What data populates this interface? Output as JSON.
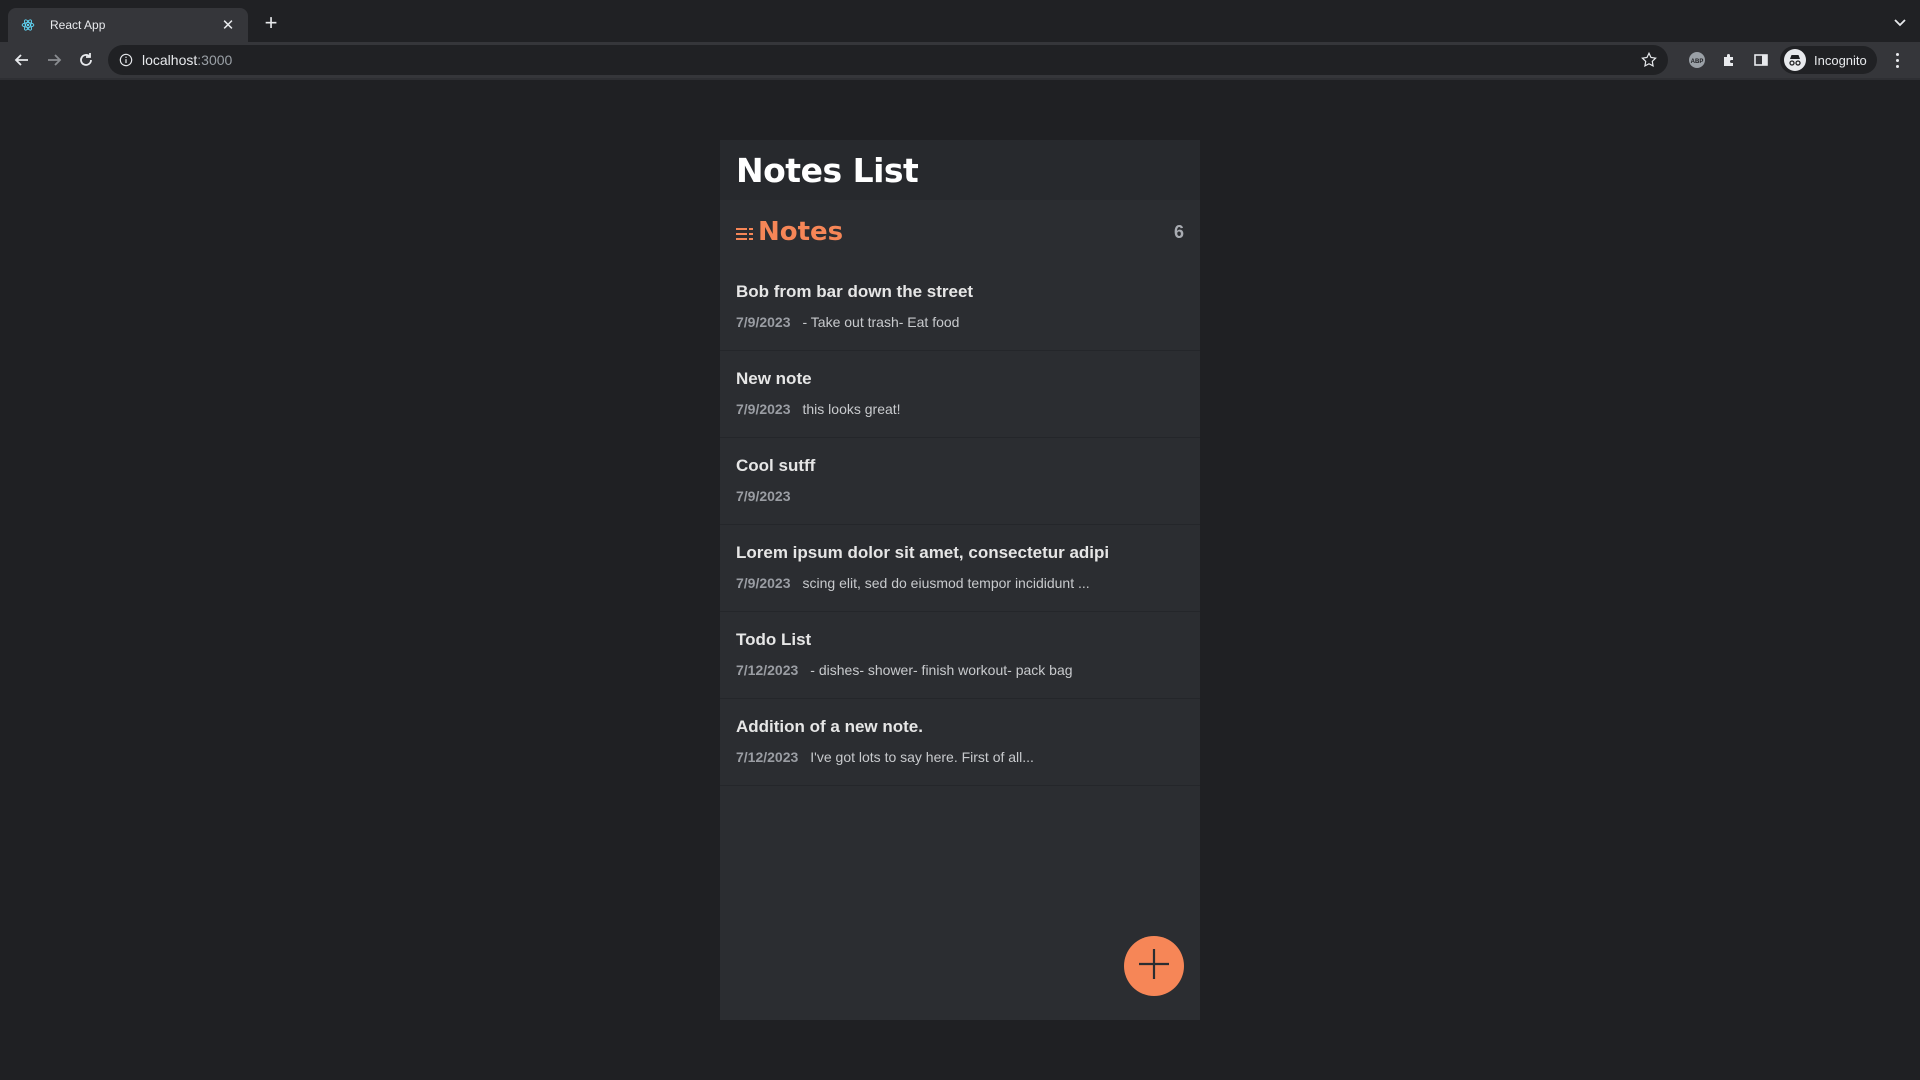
{
  "browser": {
    "tab_title": "React App",
    "url_host": "localhost",
    "url_port": ":3000",
    "profile_label": "Incognito"
  },
  "app": {
    "title": "Notes List",
    "notes_heading": "Notes",
    "notes_count": "6",
    "accent_color": "#f68657",
    "notes": [
      {
        "title": "Bob from bar down the street",
        "date": "7/9/2023",
        "preview": "- Take out trash- Eat food"
      },
      {
        "title": "New note",
        "date": "7/9/2023",
        "preview": "this looks great!"
      },
      {
        "title": "Cool sutff",
        "date": "7/9/2023",
        "preview": ""
      },
      {
        "title": "Lorem ipsum dolor sit amet, consectetur adipi",
        "date": "7/9/2023",
        "preview": "scing elit, sed do eiusmod tempor incididunt ..."
      },
      {
        "title": "Todo List",
        "date": "7/12/2023",
        "preview": "- dishes- shower- finish workout- pack bag"
      },
      {
        "title": "Addition of a new note.",
        "date": "7/12/2023",
        "preview": "I've got lots to say here. First of all..."
      }
    ],
    "add_button_icon": "plus-icon"
  }
}
